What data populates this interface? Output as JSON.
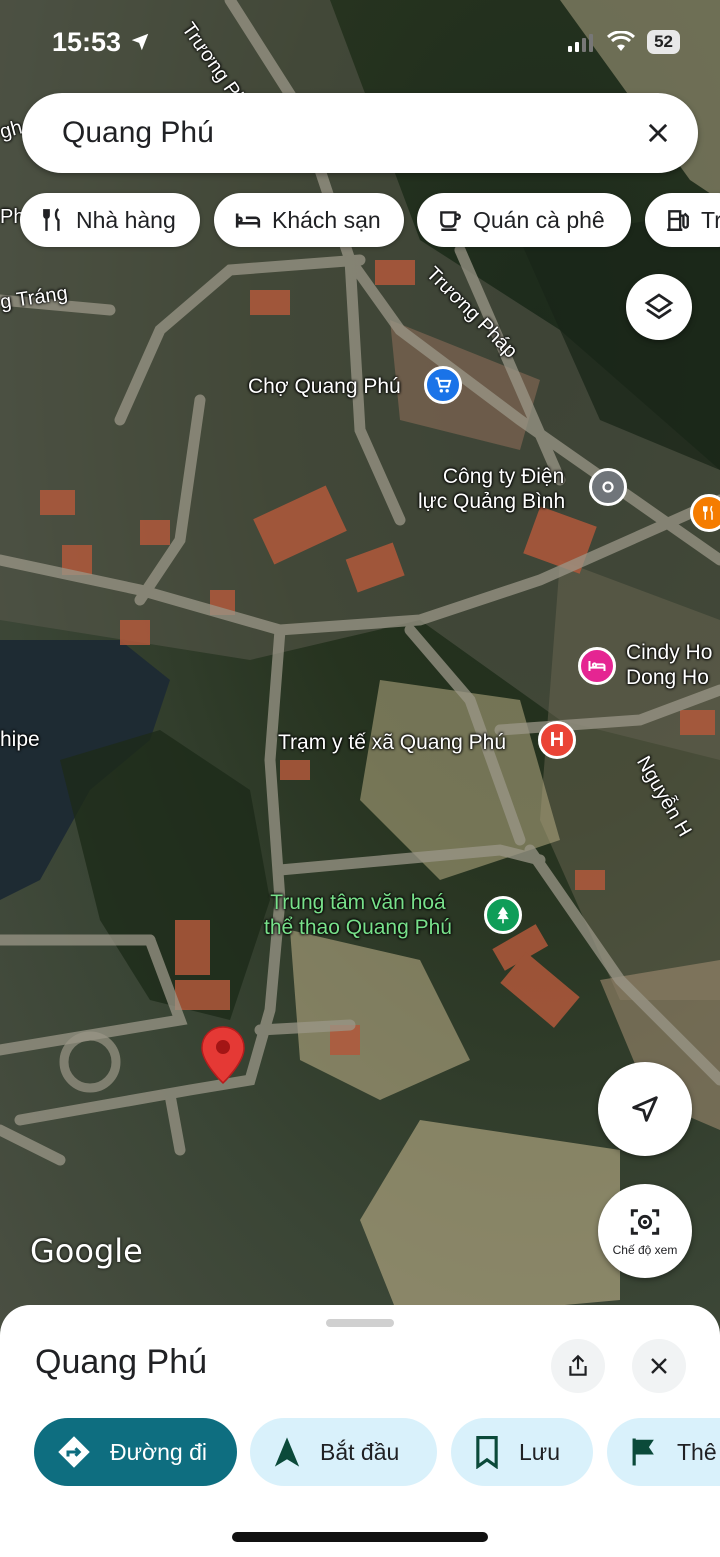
{
  "status_bar": {
    "time": "15:53",
    "battery": "52"
  },
  "search": {
    "query": "Quang Phú"
  },
  "chips": [
    {
      "label": "Nhà hàng",
      "icon": "fork-knife-icon"
    },
    {
      "label": "Khách sạn",
      "icon": "bed-icon"
    },
    {
      "label": "Quán cà phê",
      "icon": "coffee-cup-icon"
    },
    {
      "label": "Tr",
      "icon": "gas-station-icon"
    }
  ],
  "map": {
    "streets": [
      "Trương Pháp",
      "Trương Pháp",
      "g Tráng",
      "Nguyễn H",
      "Ph",
      "gh"
    ],
    "places": [
      {
        "name": "Chợ Quang Phú",
        "type": "shopping"
      },
      {
        "name_line1": "Công ty Điện",
        "name_line2": "lực Quảng Bình",
        "type": "office"
      },
      {
        "name_line1": "Cindy Ho",
        "name_line2": "Dong Ho",
        "type": "hotel"
      },
      {
        "name": "Trạm y tế xã Quang Phú",
        "type": "hospital"
      },
      {
        "name_line1": "Trung tâm văn hoá",
        "name_line2": "thể thao Quang Phú",
        "type": "park"
      },
      {
        "name": "hipe",
        "type": "area"
      }
    ],
    "hospital_letter": "H",
    "view_mode_label": "Chế độ xem",
    "attribution": "Google",
    "colors": {
      "shopping": "#1a73e8",
      "office": "#70757a",
      "hotel": "#e52592",
      "hospital": "#ea4335",
      "park": "#0f9d58",
      "restaurant": "#f57c00",
      "pin": "#e53935"
    }
  },
  "sheet": {
    "title": "Quang Phú",
    "actions": [
      {
        "label": "Đường đi",
        "icon": "directions-icon"
      },
      {
        "label": "Bắt đầu",
        "icon": "navigation-arrow-icon"
      },
      {
        "label": "Lưu",
        "icon": "bookmark-icon"
      },
      {
        "label": "Thê",
        "icon": "flag-icon"
      }
    ]
  }
}
